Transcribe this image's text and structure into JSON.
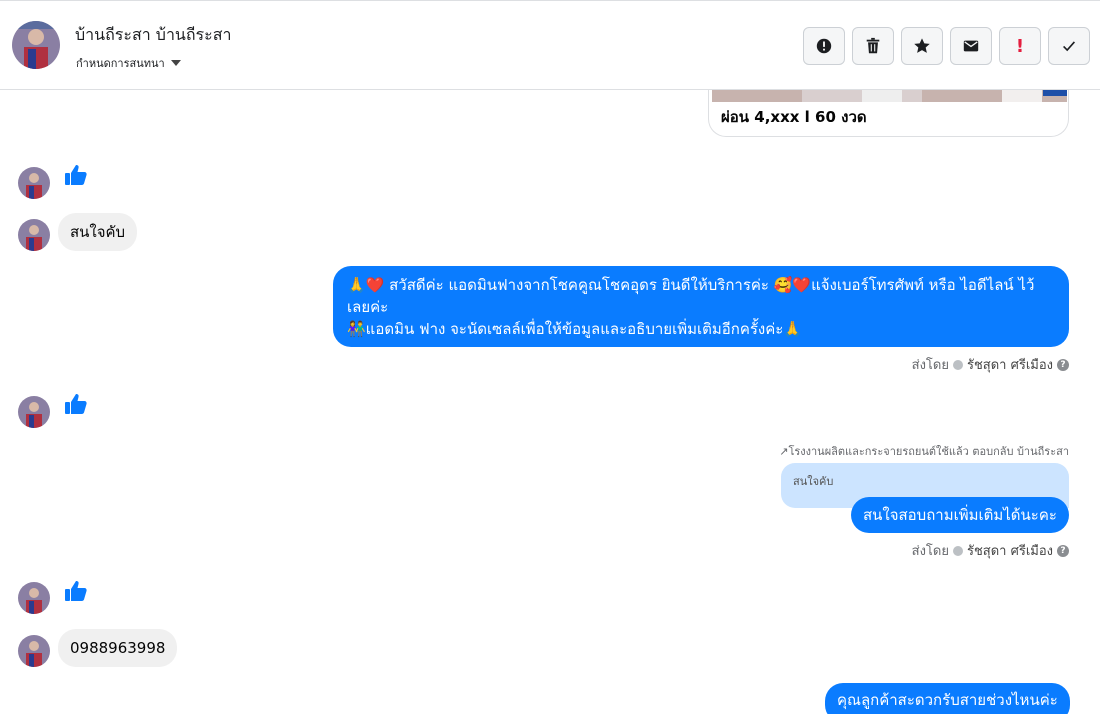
{
  "header": {
    "contact_name": "บ้านถีระสา บ้านถีระสา",
    "assign_label": "กำหนดการสนทนา",
    "toolbar": [
      {
        "name": "report-icon"
      },
      {
        "name": "trash-icon"
      },
      {
        "name": "star-icon"
      },
      {
        "name": "envelope-icon"
      },
      {
        "name": "exclamation-icon"
      },
      {
        "name": "check-icon"
      }
    ]
  },
  "card": {
    "title": "ผ่อน 4,xxx l 60 งวด"
  },
  "messages": {
    "in_1": "สนใจคับ",
    "out_1": {
      "line1": "🙏❤️ สวัสดีค่ะ แอดมินฟางจากโชคคูณโชคอุดร ยินดีให้บริการค่ะ 🥰❤️แจ้งเบอร์โทรศัพท์ หรือ ไอดีไลน์  ไว้",
      "line2": "เลยค่ะ",
      "line3": "👫แอดมิน ฟาง จะนัดเซลล์เพื่อให้ข้อมูลและอธิบายเพิ่มเติมอีกครั้งค่ะ🙏"
    },
    "sent_by_label": "ส่งโดย",
    "sender_name": "รัชสุดา ศรีเมือง",
    "reply_label": "↗โรงงานผลิตและกระจายรถยนต์ใช้แล้ว ตอบกลับ บ้านถีระสา",
    "quoted_text": "สนใจคับ",
    "out_2": "สนใจสอบถามเพิ่มเติมได้นะคะ",
    "in_2": "0988963998",
    "out_3": "คุณลูกค้าสะดวกรับสายช่วงไหนค่ะ"
  },
  "colors": {
    "accent": "#0a7cff",
    "incoming_bubble": "#f0f0f0",
    "quoted_bg": "#cce4ff"
  }
}
